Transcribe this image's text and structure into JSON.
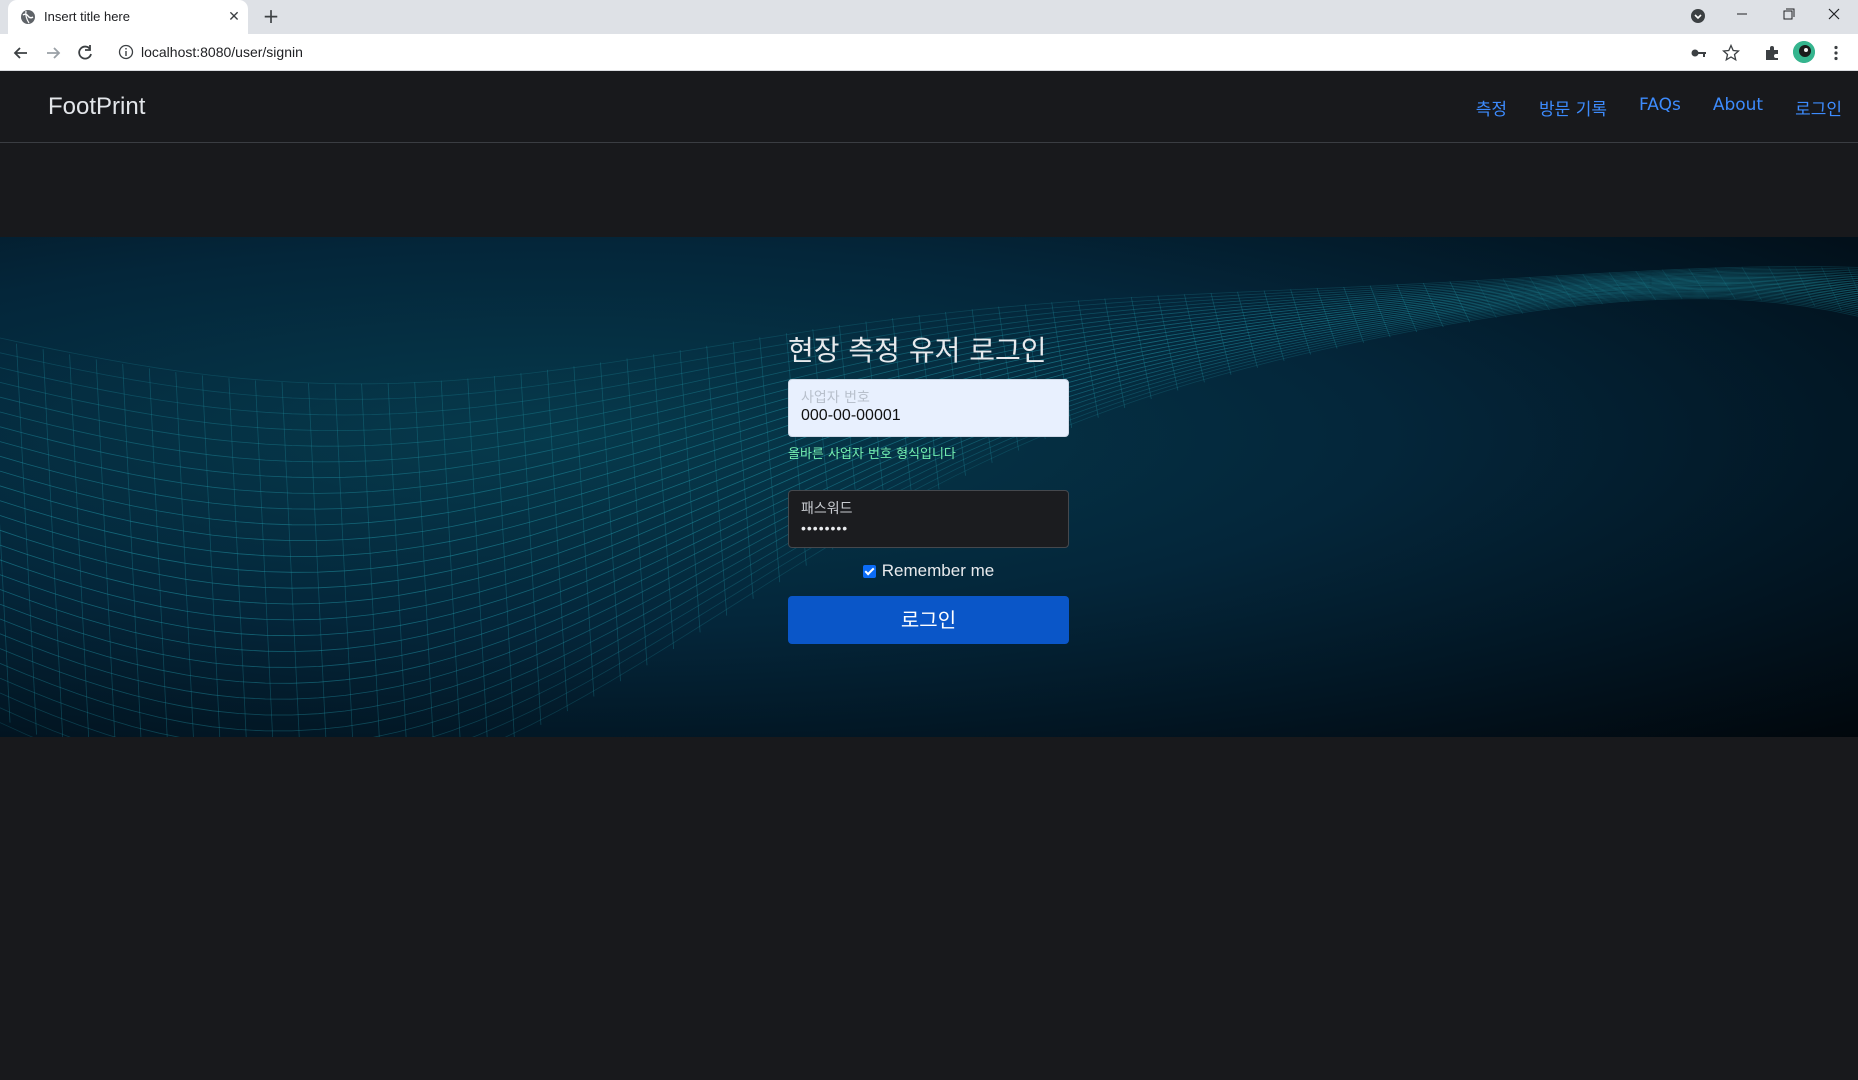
{
  "browser": {
    "tab_title": "Insert title here",
    "url": "localhost:8080/user/signin",
    "icons": [
      "globe-icon",
      "close-icon",
      "plus-icon",
      "back-icon",
      "forward-icon",
      "reload-icon",
      "info-icon",
      "key-icon",
      "star-icon",
      "puzzle-icon",
      "avatar",
      "kebab-icon"
    ]
  },
  "navbar": {
    "brand": "FootPrint",
    "links": [
      "측정",
      "방문 기록",
      "FAQs",
      "About",
      "로그인"
    ]
  },
  "login": {
    "title": "현장 측정 유저 로그인",
    "business_number": {
      "label": "사업자 번호",
      "value": "000-00-00001",
      "validation": "올바른 사업자 번호 형식입니다"
    },
    "password": {
      "label": "패스워드",
      "value": "••••••••"
    },
    "remember_me": {
      "label": "Remember me",
      "checked": true
    },
    "submit_label": "로그인"
  },
  "colors": {
    "page_bg": "#18191c",
    "link": "#3d8bfd",
    "button": "#0a56c8",
    "valid": "#75f0b0",
    "hero_mesh": "#1f8fa0"
  }
}
